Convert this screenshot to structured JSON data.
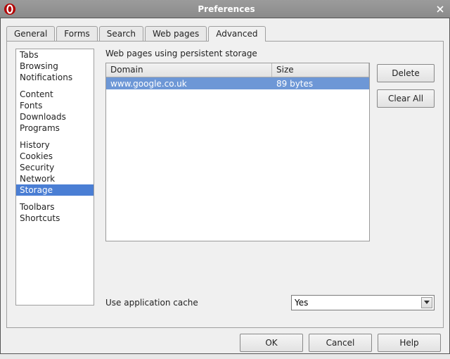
{
  "window": {
    "title": "Preferences"
  },
  "tabs": {
    "general": "General",
    "forms": "Forms",
    "search": "Search",
    "webpages": "Web pages",
    "advanced": "Advanced"
  },
  "sidebar": {
    "tabs": "Tabs",
    "browsing": "Browsing",
    "notifications": "Notifications",
    "content": "Content",
    "fonts": "Fonts",
    "downloads": "Downloads",
    "programs": "Programs",
    "history": "History",
    "cookies": "Cookies",
    "security": "Security",
    "network": "Network",
    "storage": "Storage",
    "toolbars": "Toolbars",
    "shortcuts": "Shortcuts"
  },
  "main": {
    "heading": "Web pages using persistent storage",
    "columns": {
      "domain": "Domain",
      "size": "Size"
    },
    "rows": [
      {
        "domain": "www.google.co.uk",
        "size": "89 bytes"
      }
    ],
    "buttons": {
      "delete": "Delete",
      "clear_all": "Clear All"
    },
    "cache_label": "Use application cache",
    "cache_value": "Yes"
  },
  "footer": {
    "ok": "OK",
    "cancel": "Cancel",
    "help": "Help"
  }
}
